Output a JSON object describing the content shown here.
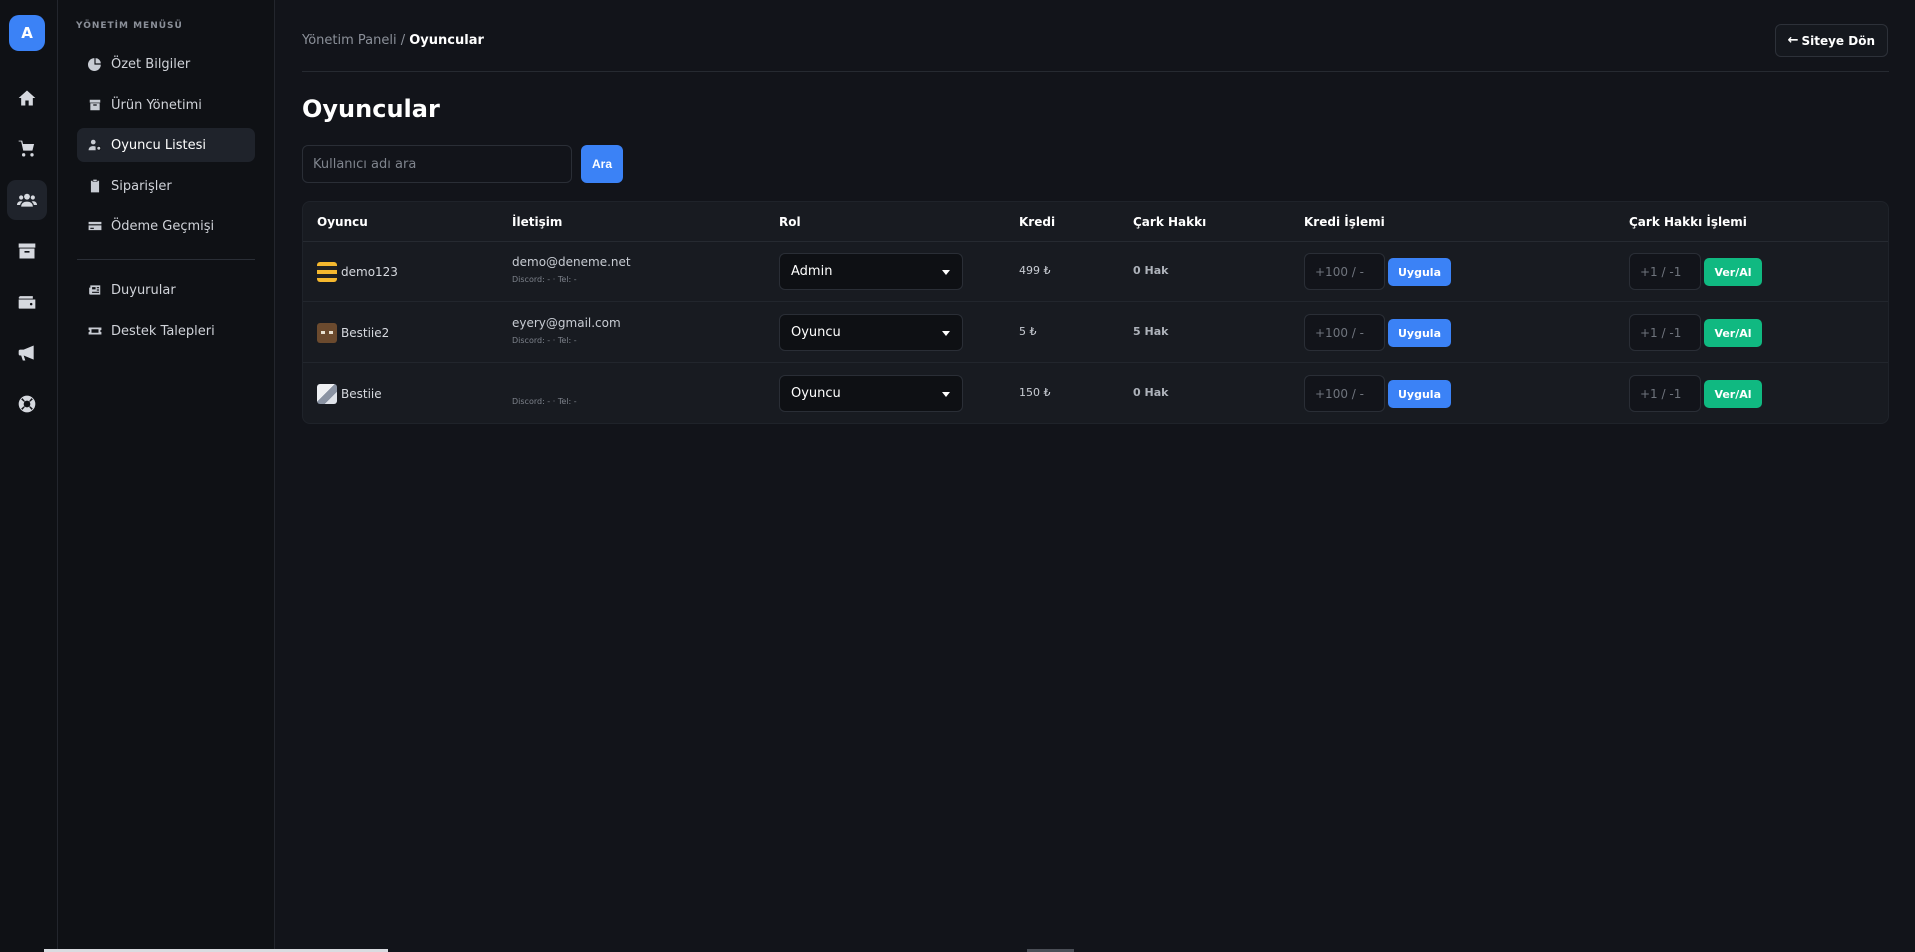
{
  "rail": {
    "logo_letter": "A",
    "icons": [
      "home-icon",
      "cart-icon",
      "users-icon",
      "archive-icon",
      "wallet-icon",
      "megaphone-icon",
      "support-icon"
    ],
    "active_icon": "users-icon"
  },
  "sidebar": {
    "heading": "YÖNETİM MENÜSÜ",
    "items": [
      {
        "label": "Özet Bilgiler",
        "icon": "pie-chart-icon"
      },
      {
        "label": "Ürün Yönetimi",
        "icon": "box-icon"
      },
      {
        "label": "Oyuncu Listesi",
        "icon": "user-cog-icon",
        "active": true
      },
      {
        "label": "Siparişler",
        "icon": "clipboard-icon"
      },
      {
        "label": "Ödeme Geçmişi",
        "icon": "credit-card-icon"
      },
      {
        "label": "Duyurular",
        "icon": "newspaper-icon"
      },
      {
        "label": "Destek Talepleri",
        "icon": "ticket-icon"
      }
    ]
  },
  "header": {
    "breadcrumb_parent": "Yönetim Paneli",
    "breadcrumb_separator": " / ",
    "breadcrumb_current": "Oyuncular",
    "back_label": "Siteye Dön"
  },
  "page": {
    "title": "Oyuncular",
    "search_placeholder": "Kullanıcı adı ara",
    "search_button": "Ara"
  },
  "table": {
    "columns": [
      "Oyuncu",
      "İletişim",
      "Rol",
      "Kredi",
      "Çark Hakkı",
      "Kredi İşlemi",
      "Çark Hakkı İşlemi"
    ],
    "rows": [
      {
        "player": "demo123",
        "avatar": "bee",
        "email": "demo@deneme.net",
        "discord": "Discord: - · Tel: -",
        "role": "Admin",
        "credit": "499 ₺",
        "spins": "0 Hak",
        "credit_placeholder": "+100 / -",
        "apply": "Uygula",
        "spin_placeholder": "+1 / -1",
        "give": "Ver/Al"
      },
      {
        "player": "Bestiie2",
        "avatar": "brown",
        "email": "eyery@gmail.com",
        "discord": "Discord: - · Tel: -",
        "role": "Oyuncu",
        "credit": "5 ₺",
        "spins": "5 Hak",
        "credit_placeholder": "+100 / -",
        "apply": "Uygula",
        "spin_placeholder": "+1 / -1",
        "give": "Ver/Al"
      },
      {
        "player": "Bestiie",
        "avatar": "grey",
        "email": "",
        "discord": "Discord: - · Tel: -",
        "role": "Oyuncu",
        "credit": "150 ₺",
        "spins": "0 Hak",
        "credit_placeholder": "+100 / -",
        "apply": "Uygula",
        "spin_placeholder": "+1 / -1",
        "give": "Ver/Al"
      }
    ]
  },
  "colors": {
    "accent_blue": "#3b82f6",
    "accent_green": "#10b981",
    "background": "#12141a",
    "sidebar_bg": "#0f1115"
  }
}
